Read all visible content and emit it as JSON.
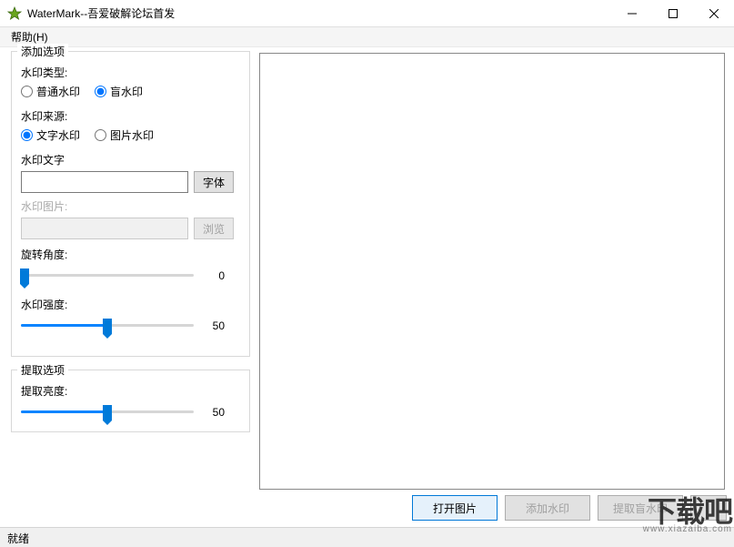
{
  "titlebar": {
    "title": "WaterMark--吾爱破解论坛首发"
  },
  "menu": {
    "help": "帮助(H)"
  },
  "add_options": {
    "legend": "添加选项",
    "wm_type_label": "水印类型:",
    "wm_type_normal": "普通水印",
    "wm_type_blind": "盲水印",
    "wm_type_selected": "blind",
    "wm_source_label": "水印来源:",
    "wm_source_text": "文字水印",
    "wm_source_image": "图片水印",
    "wm_source_selected": "text",
    "wm_text_label": "水印文字",
    "wm_text_value": "",
    "font_btn": "字体",
    "wm_image_label": "水印图片:",
    "wm_image_value": "",
    "browse_btn": "浏览",
    "rotate_label": "旋转角度:",
    "rotate_value": 0,
    "rotate_max": 360,
    "strength_label": "水印强度:",
    "strength_value": 50,
    "strength_max": 100
  },
  "extract_options": {
    "legend": "提取选项",
    "brightness_label": "提取亮度:",
    "brightness_value": 50,
    "brightness_max": 100
  },
  "buttons": {
    "open_image": "打开图片",
    "add_wm": "添加水印",
    "extract_blind": "提取盲水印"
  },
  "statusbar": {
    "text": "就绪"
  },
  "overlay_logo": {
    "main": "下载吧",
    "sub": "www.xiazaiba.com"
  }
}
